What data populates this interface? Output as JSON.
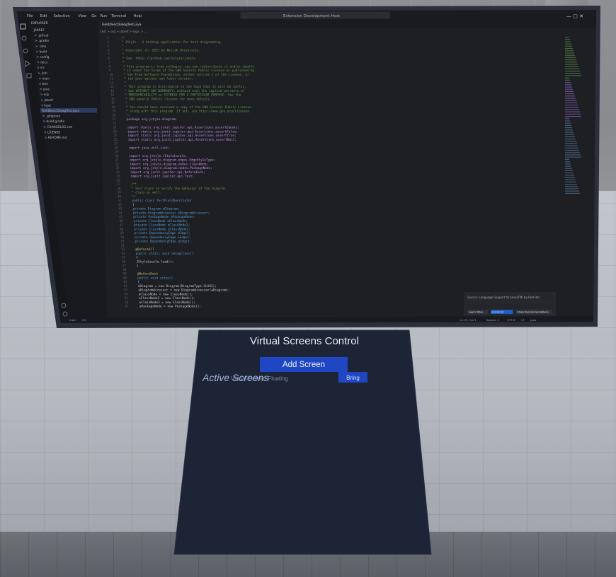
{
  "editor": {
    "window_title": "Extension Development Host",
    "menu": [
      "File",
      "Edit",
      "Selection",
      "View",
      "Go",
      "Run",
      "Terminal",
      "Help"
    ],
    "tab_label": "FieldDescDialogTest.java",
    "breadcrumb": "test > org > jabref > logic > ...",
    "explorer_title": "EXPLORER",
    "tree_items": [
      "JABREF",
      "> .github",
      "> .gradle",
      "> .idea",
      "> build",
      "> config",
      "> docs",
      "v src",
      "  > jmh",
      "  > main",
      "  v test",
      "    > java",
      "      > org",
      "        > jabref",
      "          v logic",
      "            FieldDescDialogTest.java",
      "> .gitignore",
      "> build.gradle",
      "> CHANGELOG.md",
      "> LICENSE",
      "> README.md"
    ],
    "code_lines": [
      "/*",
      " * JStyle - A desktop application for text diagramming.",
      " *",
      " * Copyright (C) 2023 by Nelsik University.",
      " *",
      " * See: https://github.com/jstyle/jstyle",
      " *",
      " * This program is free software: you can redistribute it and/or modify",
      " * it under the terms of the GNU General Public License as published by",
      " * the Free Software Foundation, either version 3 of the License, or",
      " * (at your option) any later version.",
      " *",
      " * This program is distributed in the hope that it will be useful,",
      " * but WITHOUT ANY WARRANTY; without even the implied warranty of",
      " * MERCHANTABILITY or FITNESS FOR A PARTICULAR PURPOSE.  See the",
      " * GNU General Public License for more details.",
      " *",
      " * You should have received a copy of the GNU General Public License",
      " * along with this program.  If not, see http://www.gnu.org/licenses",
      " */",
      "package org.jstyle.diagram;",
      "",
      "import static org.junit.jupiter.api.Assertions.assertEquals;",
      "import static org.junit.jupiter.api.Assertions.assertFalse;",
      "import static org.junit.jupiter.api.Assertions.assertTrue;",
      "import static org.junit.jupiter.api.Assertions.assertNull;",
      "",
      "import java.util.List;",
      "",
      "import org.jstyle.JStyleLocale;",
      "import org.jstyle.diagram.edges.EdgeStyleType;",
      "import org.jstyle.diagram.nodes.ClassNode;",
      "import org.jstyle.diagram.nodes.PackageNode;",
      "import org.junit.jupiter.api.BeforeEach;",
      "import org.junit.jupiter.api.Test;",
      "",
      "/**",
      " * Test class to verify the behavior of the diagram",
      " * class as well.",
      " */",
      "public class TestFieldDescriptor",
      "{",
      "    private Diagram aDiagram;",
      "    private DiagramAccessor aDiagramAccessor;",
      "    private PackageNode aPackageNode;",
      "    private ClassNode aClassNode;",
      "    private ClassNode aClassNode2;",
      "    private ClassNode aClassNode3;",
      "    private DependencyEdge aEdge1;",
      "    private DependencyEdge aEdge2;",
      "    private DependencyEdge aEdge3;",
      "",
      "    @BeforeAll",
      "    public static void setupClass()",
      "    {",
      "        JStyleLocale.load();",
      "    }",
      "",
      "    @BeforeEach",
      "    public void setup()",
      "    {",
      "        aDiagram = new Diagram(DiagramType.CLASS);",
      "        aDiagramAccessor = new DiagramAccessor(aDiagram);",
      "        aClassNode = new ClassNode();",
      "        aClassNode2 = new ClassNode();",
      "        aClassNode3 = new ClassNode();",
      "        aPackageNode = new PackageNode();"
    ],
    "notification": "Source: Language Support for Java(TM) by Red Hat",
    "notification_buttons": [
      "Learn More",
      "Install All",
      "Show Recommendations"
    ],
    "status_items": [
      "main",
      "0 0",
      "Ln 22, Col 1",
      "Spaces: 4",
      "UTF-8",
      "LF",
      "Java"
    ]
  },
  "control_panel": {
    "title": "Virtual Screens Control",
    "add_screen_label": "Add Screen",
    "active_screens_label": "Active Screens",
    "active_screens_overlap": "Virtual Screen Floating",
    "bring_label": "Bring"
  },
  "colors": {
    "editor_bg": "#1e1f22",
    "sidebar_bg": "#181a1f",
    "panel_bg": "#1d2436",
    "accent_blue": "#1f47c4",
    "wall": "#8e8f93",
    "floor": "#c2c6cc"
  }
}
